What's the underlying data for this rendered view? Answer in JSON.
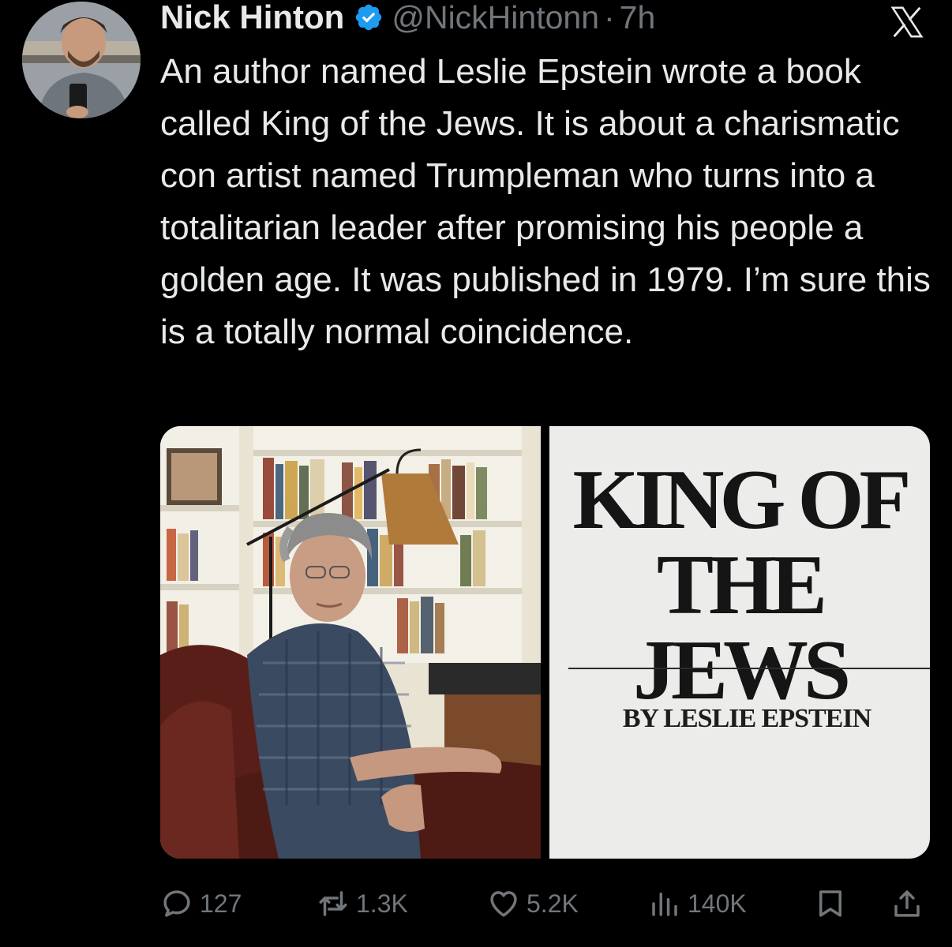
{
  "author": {
    "name": "Nick Hinton",
    "handle": "@NickHintonn",
    "separator": "·",
    "time": "7h"
  },
  "tweet": {
    "text": "An author named Leslie Epstein wrote a book called King of the Jews. It is about a charismatic con artist named Trumpleman who turns into a totalitarian leader after promising his people a golden age. It was published in 1979. I’m sure this is a totally normal coincidence."
  },
  "media": {
    "cover_title_line1": "KING OF",
    "cover_title_line2": "THE JEWS",
    "cover_author": "BY LESLIE EPSTEIN"
  },
  "actions": {
    "replies": "127",
    "reposts": "1.3K",
    "likes": "5.2K",
    "views": "140K"
  },
  "colors": {
    "background": "#000000",
    "text": "#e7e9ea",
    "muted": "#71767b",
    "verified": "#1d9bf0"
  },
  "icons": [
    "verified-badge-icon",
    "x-logo-icon",
    "reply-icon",
    "repost-icon",
    "like-icon",
    "views-icon",
    "bookmark-icon",
    "share-icon"
  ]
}
